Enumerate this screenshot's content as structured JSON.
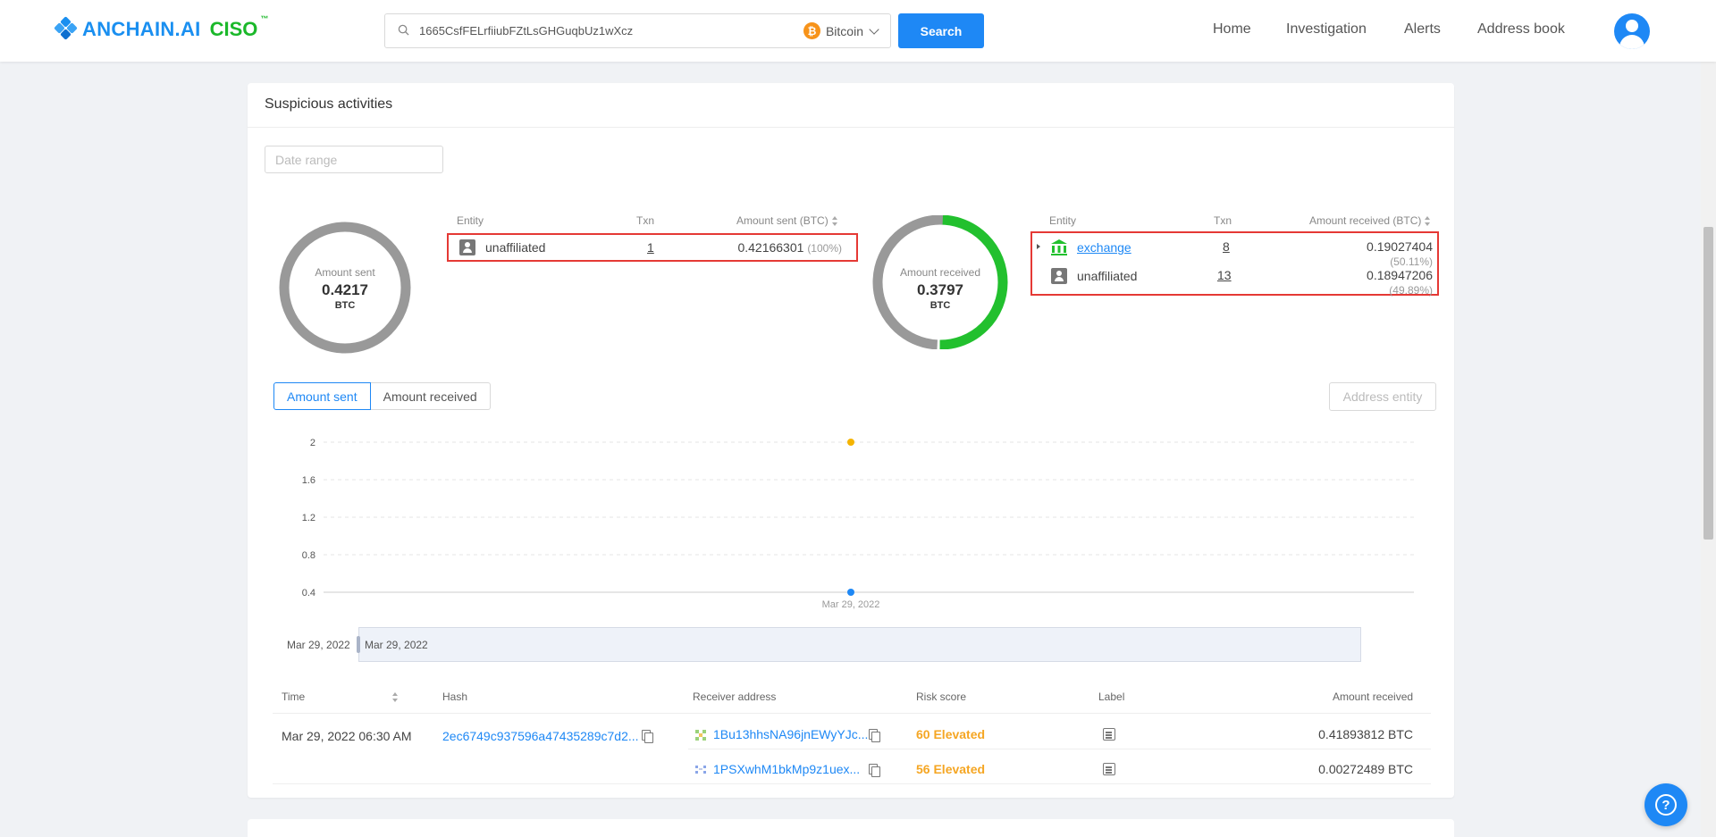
{
  "header": {
    "logo_text": "ANCHAIN.AI",
    "logo_product": "CISO",
    "logo_tm": "™",
    "search_value": "1665CsfFELrfiiubFZtLsGHGuqbUz1wXcz",
    "coin": "Bitcoin",
    "coin_symbol": "₿",
    "search_button": "Search",
    "nav": [
      "Home",
      "Investigation",
      "Alerts",
      "Address book"
    ]
  },
  "card": {
    "title": "Suspicious activities",
    "date_range_placeholder": "Date range"
  },
  "sent_donut": {
    "label": "Amount sent",
    "value": "0.4217",
    "unit": "BTC",
    "color": "#999999"
  },
  "sent_table": {
    "headers": {
      "entity": "Entity",
      "txn": "Txn",
      "amount": "Amount sent (BTC)"
    },
    "rows": [
      {
        "icon": "person-icon",
        "entity": "unaffiliated",
        "txn": "1",
        "amount": "0.42166301",
        "pct": "(100%)"
      }
    ]
  },
  "received_donut": {
    "label": "Amount received",
    "value": "0.3797",
    "unit": "BTC",
    "segments": [
      {
        "name": "exchange",
        "fraction": 0.5011,
        "color": "#22c02e"
      },
      {
        "name": "unaffiliated",
        "fraction": 0.4989,
        "color": "#999999"
      }
    ]
  },
  "received_table": {
    "headers": {
      "entity": "Entity",
      "txn": "Txn",
      "amount": "Amount received (BTC)"
    },
    "rows": [
      {
        "icon": "bank-icon",
        "entity": "exchange",
        "txn": "8",
        "amount": "0.19027404",
        "pct": "(50.11%)"
      },
      {
        "icon": "person-icon",
        "entity": "unaffiliated",
        "txn": "13",
        "amount": "0.18947206",
        "pct": "(49.89%)"
      }
    ]
  },
  "tabs": {
    "sent": "Amount sent",
    "received": "Amount received"
  },
  "address_entity_placeholder": "Address entity",
  "chart_data": {
    "type": "scatter",
    "y_ticks": [
      "2",
      "1.6",
      "1.2",
      "0.8",
      "0.4"
    ],
    "ylim": [
      0.4,
      2
    ],
    "x_tick": "Mar 29, 2022",
    "series": [
      {
        "values": [
          {
            "x": "Mar 29, 2022",
            "y": 2
          }
        ],
        "color": "#f5b400"
      },
      {
        "values": [
          {
            "x": "Mar 29, 2022",
            "y": 0.4
          }
        ],
        "color": "#1e88f5"
      }
    ],
    "grid": true
  },
  "slider": {
    "start": "Mar 29, 2022",
    "end": "Mar 29, 2022"
  },
  "tx_table": {
    "headers": {
      "time": "Time",
      "hash": "Hash",
      "receiver": "Receiver address",
      "risk": "Risk score",
      "label": "Label",
      "amount": "Amount received"
    },
    "rows": [
      {
        "time": "Mar 29, 2022 06:30 AM",
        "hash": "2ec6749c937596a47435289c7d2...",
        "receiver": "1Bu13hhsNA96jnEWyYJc...",
        "risk": "60 Elevated",
        "amount": "0.41893812 BTC"
      },
      {
        "time": "",
        "hash": "",
        "receiver": "1PSXwhM1bkMp9z1uex...",
        "risk": "56 Elevated",
        "amount": "0.00272489 BTC"
      }
    ]
  },
  "help_symbol": "?"
}
